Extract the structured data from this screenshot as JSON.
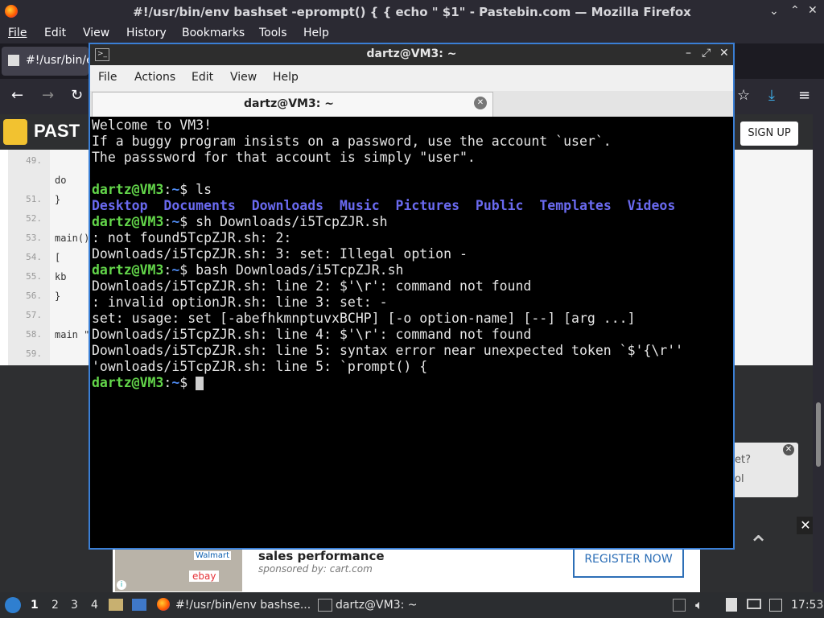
{
  "firefox": {
    "title": "#!/usr/bin/env bashset -eprompt() { { echo \" $1\" - Pastebin.com — Mozilla Firefox",
    "menu": [
      "File",
      "Edit",
      "View",
      "History",
      "Bookmarks",
      "Tools",
      "Help"
    ],
    "tab_label": "#!/usr/bin/e"
  },
  "page": {
    "logo": "PAST",
    "signup": "SIGN UP",
    "code_lines": [
      {
        "n": "49.",
        "text": ""
      },
      {
        "n": "",
        "text": "        do"
      },
      {
        "n": "51.",
        "text": "}"
      },
      {
        "n": "52.",
        "text": ""
      },
      {
        "n": "53.",
        "text": "main()"
      },
      {
        "n": "54.",
        "text": "    ["
      },
      {
        "n": "55.",
        "text": "    kb"
      },
      {
        "n": "56.",
        "text": "}"
      },
      {
        "n": "57.",
        "text": ""
      },
      {
        "n": "58.",
        "text": "main \""
      },
      {
        "n": "59.",
        "text": ""
      }
    ],
    "popup_line1": "et?",
    "popup_line2": "ol",
    "ad_title": "sales performance",
    "ad_sub": "sponsored by: cart.com",
    "ad_button": "REGISTER NOW",
    "ad_brand1": "Walmart",
    "ad_brand2": "ebay"
  },
  "terminal": {
    "window_title": "dartz@VM3: ~",
    "menu": [
      "File",
      "Actions",
      "Edit",
      "View",
      "Help"
    ],
    "tab_title": "dartz@VM3: ~",
    "prompt_user": "dartz@VM3",
    "prompt_path": "~",
    "lines": {
      "l1": "Welcome to VM3!",
      "l2": "If a buggy program insists on a password, use the account `user`.",
      "l3": "The passsword for that account is simply \"user\".",
      "cmd1": "ls",
      "dirs": [
        "Desktop",
        "Documents",
        "Downloads",
        "Music",
        "Pictures",
        "Public",
        "Templates",
        "Videos"
      ],
      "cmd2": "sh Downloads/i5TcpZJR.sh",
      "o1": ": not found5TcpZJR.sh: 2:",
      "o2": "Downloads/i5TcpZJR.sh: 3: set: Illegal option -",
      "cmd3": "bash Downloads/i5TcpZJR.sh",
      "o3": "Downloads/i5TcpZJR.sh: line 2: $'\\r': command not found",
      "o4": ": invalid optionJR.sh: line 3: set: -",
      "o5": "set: usage: set [-abefhkmnptuvxBCHP] [-o option-name] [--] [arg ...]",
      "o6": "Downloads/i5TcpZJR.sh: line 4: $'\\r': command not found",
      "o7": "Downloads/i5TcpZJR.sh: line 5: syntax error near unexpected token `$'{\\r''",
      "o8": "'ownloads/i5TcpZJR.sh: line 5: `prompt() {"
    }
  },
  "taskbar": {
    "workspaces": [
      "1",
      "2",
      "3",
      "4"
    ],
    "task1": "#!/usr/bin/env bashse...",
    "task2": "dartz@VM3: ~",
    "clock": "17:53"
  }
}
